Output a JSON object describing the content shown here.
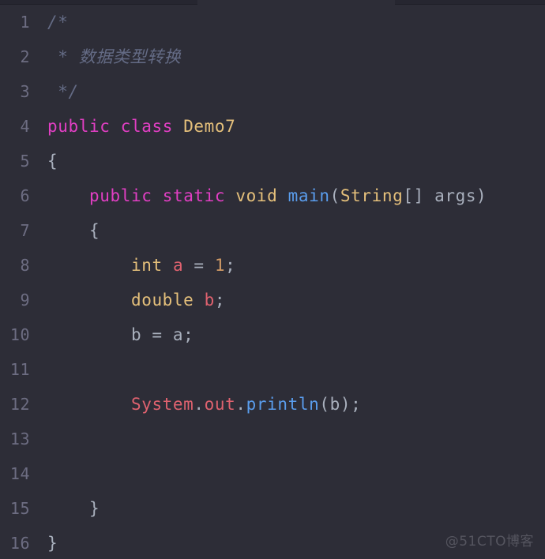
{
  "editor": {
    "background_color": "#2d2d37",
    "tab_strip_color": "#262630",
    "gutter_number_color": "#6d6d82",
    "tabs": [
      {
        "name": "tab-segment-left"
      },
      {
        "name": "tab-segment-right"
      }
    ],
    "language": "java",
    "syntax_colors": {
      "comment": "#646b85",
      "keyword": "#e23fc4",
      "type": "#e5c07b",
      "class_name": "#e5c07b",
      "method": "#5a9ded",
      "variable": "#e0626f",
      "number": "#d19a66",
      "punctuation": "#a9b0bd"
    },
    "lines": [
      {
        "number": "1",
        "tokens": [
          {
            "text": "/*",
            "type": "comment"
          }
        ]
      },
      {
        "number": "2",
        "tokens": [
          {
            "text": " * 数据类型转换",
            "type": "comment"
          }
        ]
      },
      {
        "number": "3",
        "tokens": [
          {
            "text": " */",
            "type": "comment"
          }
        ]
      },
      {
        "number": "4",
        "tokens": [
          {
            "text": "public",
            "type": "keyword"
          },
          {
            "text": " ",
            "type": "plain"
          },
          {
            "text": "class",
            "type": "keyword"
          },
          {
            "text": " ",
            "type": "plain"
          },
          {
            "text": "Demo7",
            "type": "class"
          }
        ]
      },
      {
        "number": "5",
        "tokens": [
          {
            "text": "{",
            "type": "punct"
          }
        ]
      },
      {
        "number": "6",
        "tokens": [
          {
            "text": "    ",
            "type": "plain"
          },
          {
            "text": "public",
            "type": "keyword"
          },
          {
            "text": " ",
            "type": "plain"
          },
          {
            "text": "static",
            "type": "keyword"
          },
          {
            "text": " ",
            "type": "plain"
          },
          {
            "text": "void",
            "type": "type"
          },
          {
            "text": " ",
            "type": "plain"
          },
          {
            "text": "main",
            "type": "method"
          },
          {
            "text": "(",
            "type": "punct"
          },
          {
            "text": "String",
            "type": "type"
          },
          {
            "text": "[] args)",
            "type": "punct"
          }
        ]
      },
      {
        "number": "7",
        "tokens": [
          {
            "text": "    {",
            "type": "punct"
          }
        ]
      },
      {
        "number": "8",
        "tokens": [
          {
            "text": "        ",
            "type": "plain"
          },
          {
            "text": "int",
            "type": "type"
          },
          {
            "text": " ",
            "type": "plain"
          },
          {
            "text": "a",
            "type": "var"
          },
          {
            "text": " = ",
            "type": "punct"
          },
          {
            "text": "1",
            "type": "number"
          },
          {
            "text": ";",
            "type": "punct"
          }
        ]
      },
      {
        "number": "9",
        "tokens": [
          {
            "text": "        ",
            "type": "plain"
          },
          {
            "text": "double",
            "type": "type"
          },
          {
            "text": " ",
            "type": "plain"
          },
          {
            "text": "b",
            "type": "var"
          },
          {
            "text": ";",
            "type": "punct"
          }
        ]
      },
      {
        "number": "10",
        "tokens": [
          {
            "text": "        b = a;",
            "type": "punct"
          }
        ]
      },
      {
        "number": "11",
        "tokens": []
      },
      {
        "number": "12",
        "tokens": [
          {
            "text": "        ",
            "type": "plain"
          },
          {
            "text": "System",
            "type": "object"
          },
          {
            "text": ".",
            "type": "punct"
          },
          {
            "text": "out",
            "type": "object"
          },
          {
            "text": ".",
            "type": "punct"
          },
          {
            "text": "println",
            "type": "method"
          },
          {
            "text": "(b);",
            "type": "punct"
          }
        ]
      },
      {
        "number": "13",
        "tokens": []
      },
      {
        "number": "14",
        "tokens": []
      },
      {
        "number": "15",
        "tokens": [
          {
            "text": "    }",
            "type": "punct"
          }
        ]
      },
      {
        "number": "16",
        "tokens": [
          {
            "text": "}",
            "type": "punct"
          }
        ]
      }
    ]
  },
  "watermark": {
    "text": "@51CTO博客"
  }
}
